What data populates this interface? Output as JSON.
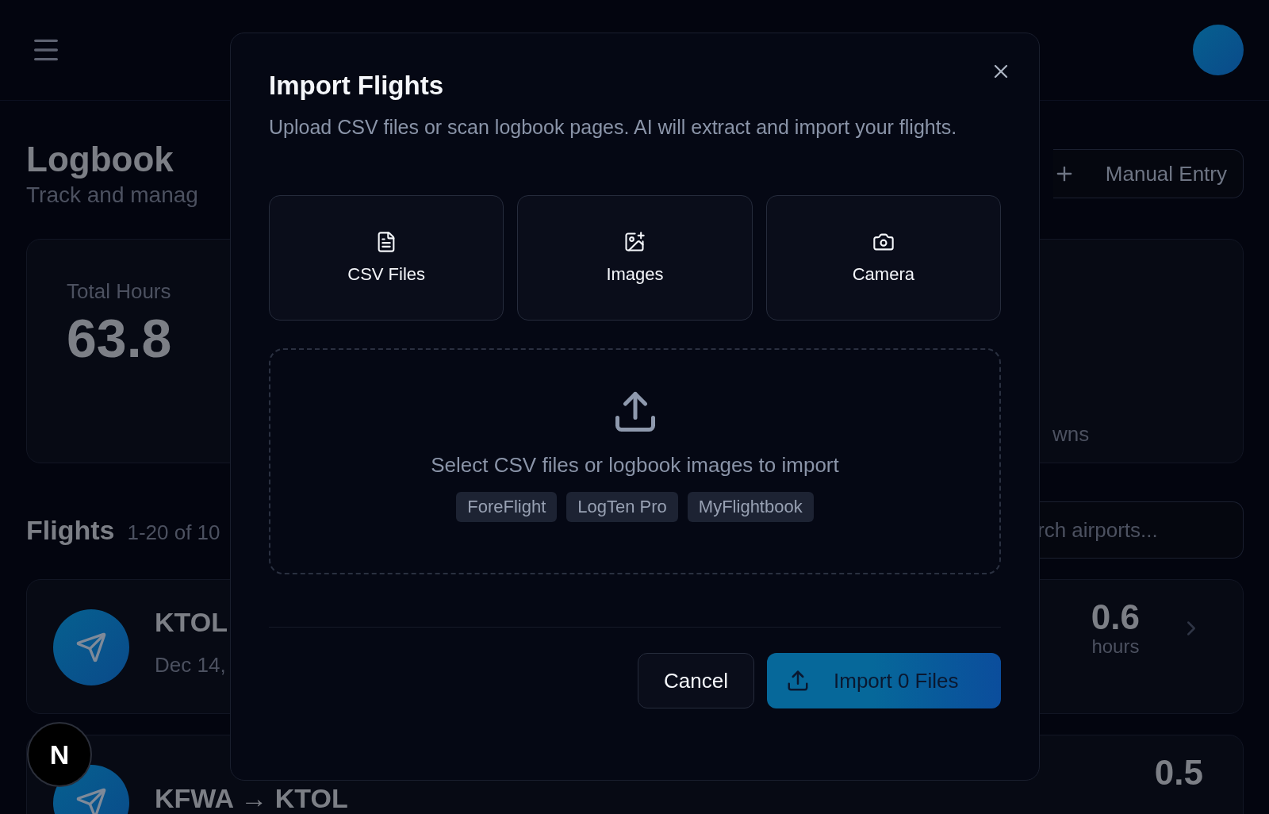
{
  "page": {
    "title": "Logbook",
    "subtitle": "Track and manag",
    "action": {
      "label": "Manual Entry"
    }
  },
  "stats": {
    "label": "Total Hours",
    "value": "63.8",
    "right_label": "wns"
  },
  "flights": {
    "title": "Flights",
    "count": "1-20 of 10",
    "search": {
      "placeholder": "rch airports..."
    },
    "items": [
      {
        "route": "KTOL",
        "date": "Dec 14,",
        "hours": "0.6",
        "unit": "hours"
      },
      {
        "route": "KFWA → KTOL",
        "hours": "0.5"
      }
    ]
  },
  "dev_badge": {
    "label": "N"
  },
  "dialog": {
    "title": "Import Flights",
    "description": "Upload CSV files or scan logbook pages. AI will extract and import your flights.",
    "sources": [
      {
        "kind": "csv",
        "label": "CSV Files"
      },
      {
        "kind": "images",
        "label": "Images"
      },
      {
        "kind": "camera",
        "label": "Camera"
      }
    ],
    "dropzone": {
      "text": "Select CSV files or logbook images to import",
      "formats": [
        "ForeFlight",
        "LogTen Pro",
        "MyFlightbook"
      ]
    },
    "buttons": [
      {
        "kind": "secondary",
        "label": "Cancel"
      },
      {
        "kind": "primary",
        "label": "Import 0 Files"
      }
    ]
  }
}
